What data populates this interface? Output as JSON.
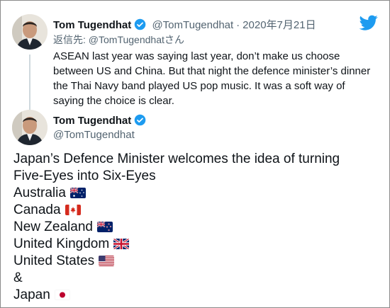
{
  "icons": {
    "brand": "twitter-bird-icon",
    "verified": "verified-badge-icon",
    "avatar": "profile-photo"
  },
  "colors": {
    "brand": "#1d9bf0",
    "text": "#0f1419",
    "secondary": "#536471"
  },
  "reply_tweet": {
    "name": "Tom Tugendhat",
    "handle": "@TomTugendhat",
    "separator": "·",
    "date": "2020年7月21日",
    "reply_prefix": "返信先:",
    "reply_target": "@TomTugendhatさん",
    "text": "ASEAN last year was saying last year, don’t make us choose between US and China. But that night the defence minister’s dinner the Thai Navy band played US pop music. It was a soft way of saying the choice is clear."
  },
  "main_tweet": {
    "name": "Tom Tugendhat",
    "handle": "@TomTugendhat",
    "lines": [
      "Japan’s Defence Minister welcomes the idea of turning",
      "Five-Eyes into Six-Eyes"
    ],
    "countries": [
      {
        "name": "Australia",
        "flag": "australia-flag-icon"
      },
      {
        "name": "Canada",
        "flag": "canada-flag-icon"
      },
      {
        "name": "New Zealand",
        "flag": "new-zealand-flag-icon"
      },
      {
        "name": "United Kingdom",
        "flag": "uk-flag-icon"
      },
      {
        "name": "United States",
        "flag": "us-flag-icon"
      }
    ],
    "ampersand": "&",
    "last_country": {
      "name": "Japan",
      "flag": "japan-flag-icon"
    }
  }
}
